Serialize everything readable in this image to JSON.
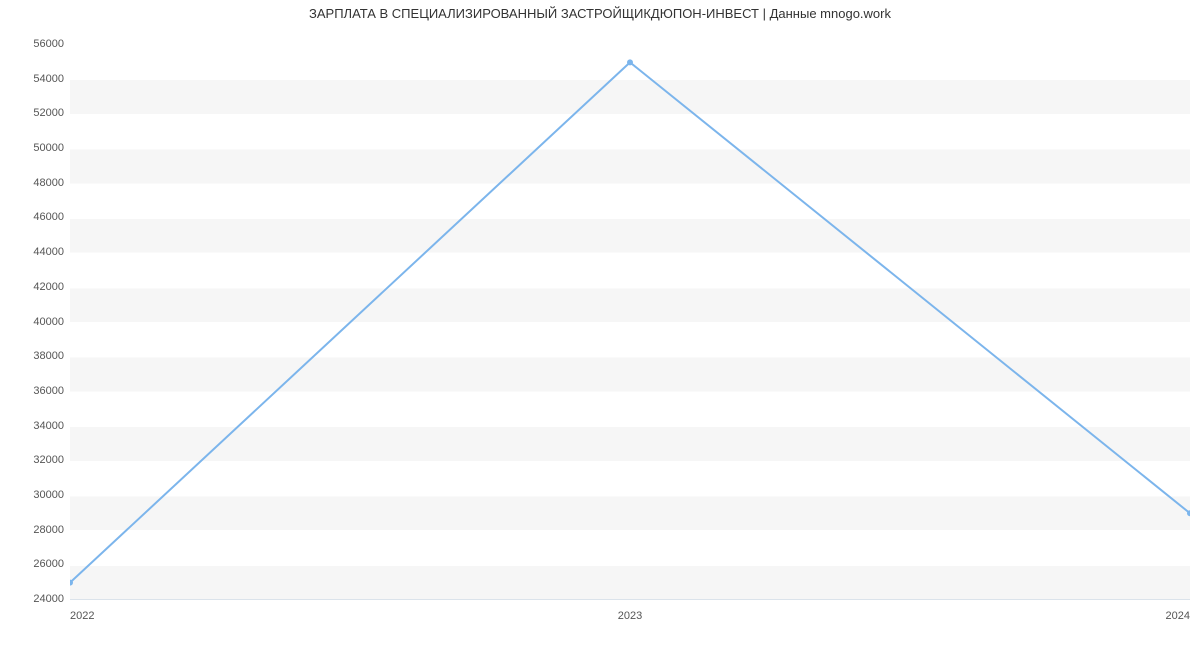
{
  "chart_data": {
    "type": "line",
    "title": "ЗАРПЛАТА В  СПЕЦИАЛИЗИРОВАННЫЙ ЗАСТРОЙЩИКДЮПОН-ИНВЕСТ | Данные mnogo.work",
    "xlabel": "",
    "ylabel": "",
    "categories": [
      "2022",
      "2023",
      "2024"
    ],
    "values": [
      25000,
      55000,
      29000
    ],
    "ylim": [
      24000,
      56000
    ],
    "yticks": [
      24000,
      26000,
      28000,
      30000,
      32000,
      34000,
      36000,
      38000,
      40000,
      42000,
      44000,
      46000,
      48000,
      50000,
      52000,
      54000,
      56000
    ],
    "grid": true
  }
}
